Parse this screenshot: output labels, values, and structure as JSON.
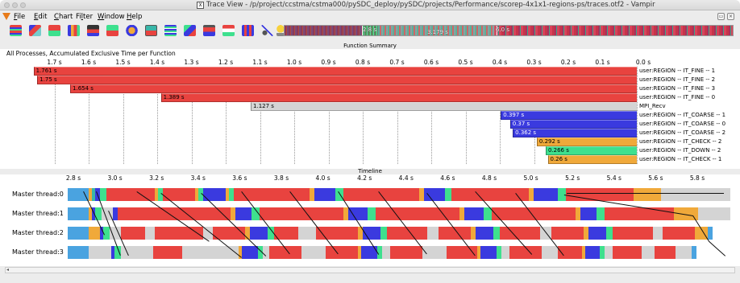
{
  "window": {
    "title": "Trace View - /p/project/ccstma/cstma000/pySDC_deploy/pySDC/projects/Performance/scorep-4x1x1-regions-ps/traces.otf2 - Vampir",
    "title_icon": "X"
  },
  "menubar": {
    "items": [
      {
        "label": "File",
        "ul": "F",
        "rest": "ile"
      },
      {
        "label": "Edit",
        "ul": "E",
        "rest": "dit"
      },
      {
        "label": "Chart",
        "ul": "C",
        "rest": "hart"
      },
      {
        "label": "Filter",
        "pre": "Fi",
        "ul": "l",
        "rest": "ter"
      },
      {
        "label": "Window",
        "ul": "W",
        "rest": "indow"
      },
      {
        "label": "Help",
        "ul": "H",
        "rest": "elp"
      }
    ]
  },
  "overview": {
    "label1": "2.8 s",
    "label2": "3.179 s",
    "label3": "6.0 s"
  },
  "function_summary": {
    "panel_title": "Function Summary",
    "subtitle": "All Processes, Accumulated Exclusive Time per Function",
    "ticks": [
      "1.7 s",
      "1.6 s",
      "1.5 s",
      "1.4 s",
      "1.3 s",
      "1.2 s",
      "1.1 s",
      "1.0 s",
      "0.9 s",
      "0.8 s",
      "0.7 s",
      "0.6 s",
      "0.5 s",
      "0.4 s",
      "0.3 s",
      "0.2 s",
      "0.1 s",
      "0.0 s"
    ],
    "rows": [
      {
        "value": "1.761 s",
        "num": 1.761,
        "name": "user:REGION -- IT_FINE -- 1",
        "color": "#e8433f"
      },
      {
        "value": "1.75 s",
        "num": 1.75,
        "name": "user:REGION -- IT_FINE -- 2",
        "color": "#e8433f"
      },
      {
        "value": "1.654 s",
        "num": 1.654,
        "name": "user:REGION -- IT_FINE -- 3",
        "color": "#e8433f"
      },
      {
        "value": "1.389 s",
        "num": 1.389,
        "name": "user:REGION -- IT_FINE -- 0",
        "color": "#e8433f"
      },
      {
        "value": "1.127 s",
        "num": 1.127,
        "name": "MPI_Recv",
        "color": "#d4d4d4"
      },
      {
        "value": "0.397 s",
        "num": 0.397,
        "name": "user:REGION -- IT_COARSE -- 1",
        "color": "#3a3adf"
      },
      {
        "value": "0.37 s",
        "num": 0.37,
        "name": "user:REGION -- IT_COARSE -- 0",
        "color": "#3a3adf"
      },
      {
        "value": "0.362 s",
        "num": 0.362,
        "name": "user:REGION -- IT_COARSE -- 2",
        "color": "#3a3adf"
      },
      {
        "value": "0.292 s",
        "num": 0.292,
        "name": "user:REGION -- IT_CHECK -- 2",
        "color": "#f0a93a"
      },
      {
        "value": "0.266 s",
        "num": 0.266,
        "name": "user:REGION -- IT_DOWN -- 2",
        "color": "#3ee08e"
      },
      {
        "value": "0.26 s",
        "num": 0.26,
        "name": "user:REGION -- IT_CHECK -- 1",
        "color": "#f0a93a"
      }
    ]
  },
  "timeline": {
    "panel_title": "Timeline",
    "ticks": [
      "2.8 s",
      "3.0 s",
      "3.2 s",
      "3.4 s",
      "3.6 s",
      "3.8 s",
      "4.0 s",
      "4.2 s",
      "4.4 s",
      "4.6 s",
      "4.8 s",
      "5.0 s",
      "5.2 s",
      "5.4 s",
      "5.6 s",
      "5.8 s"
    ],
    "threads": [
      "Master thread:0",
      "Master thread:1",
      "Master thread:2",
      "Master thread:3"
    ]
  },
  "colors": {
    "fine": "#e8433f",
    "recv": "#d4d4d4",
    "coarse": "#3a3adf",
    "check": "#f0a93a",
    "down": "#3ee08e",
    "light_blue": "#4aa3e0",
    "teal": "#39b6a8"
  },
  "scrollbar": {
    "left_arrow": "◂"
  }
}
